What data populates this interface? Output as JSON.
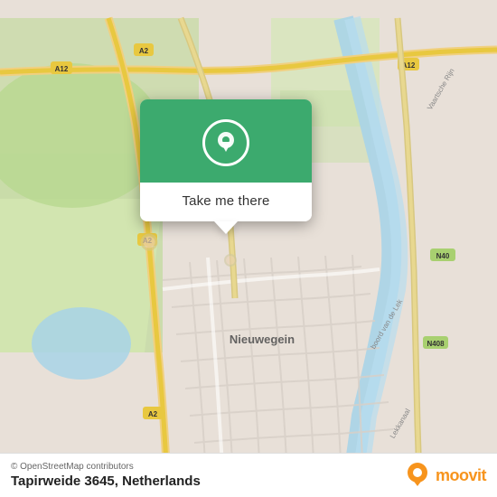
{
  "map": {
    "alt": "OpenStreetMap of Nieuwegein, Netherlands"
  },
  "popup": {
    "button_label": "Take me there",
    "icon_name": "location-pin-icon"
  },
  "bottom_bar": {
    "attribution": "© OpenStreetMap contributors",
    "address": "Tapirweide 3645, Netherlands",
    "logo_text": "moovit"
  }
}
